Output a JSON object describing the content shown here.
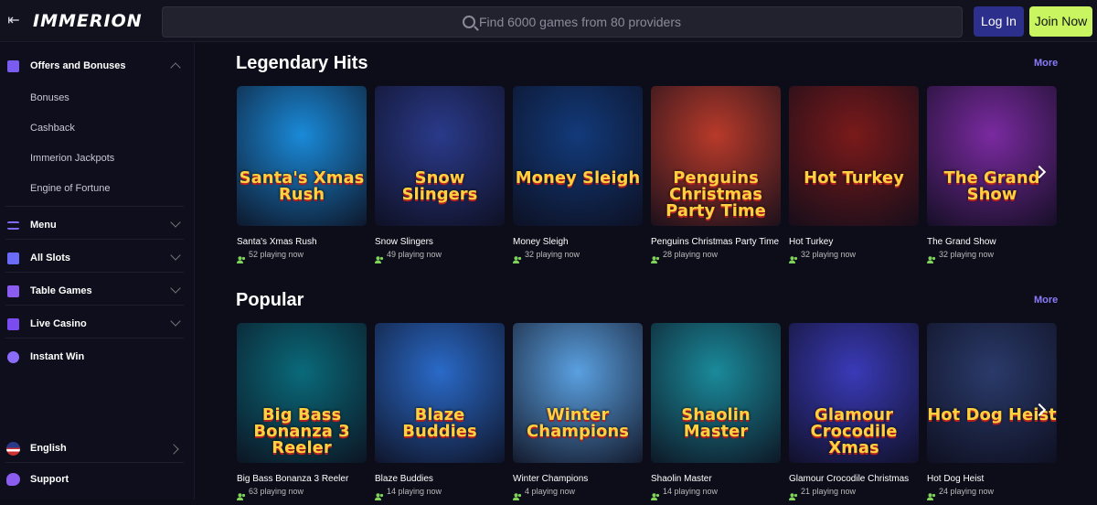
{
  "header": {
    "logo": "IMMERION",
    "search_placeholder": "Find 6000 games from 80 providers",
    "login_label": "Log In",
    "join_label": "Join Now"
  },
  "sidebar": {
    "offers": {
      "label": "Offers and Bonuses",
      "icon": "gift-icon"
    },
    "subitems": [
      "Bonuses",
      "Cashback",
      "Immerion Jackpots",
      "Engine of Fortune"
    ],
    "menu": {
      "label": "Menu",
      "icon": "menu-icon"
    },
    "all_slots": {
      "label": "All Slots",
      "icon": "grid-icon"
    },
    "table_games": {
      "label": "Table Games",
      "icon": "dice-icon"
    },
    "live_casino": {
      "label": "Live Casino",
      "icon": "play-icon"
    },
    "instant_win": {
      "label": "Instant Win",
      "icon": "burst-icon"
    },
    "language": {
      "label": "English",
      "icon": "us-flag-icon"
    },
    "support": {
      "label": "Support",
      "icon": "chat-icon"
    }
  },
  "sections": [
    {
      "title": "Legendary Hits",
      "more": "More",
      "games": [
        {
          "title": "Santa's Xmas Rush",
          "players": "52 playing now",
          "logo": "Santa's Xmas Rush",
          "color": "#1a8ad8"
        },
        {
          "title": "Snow Slingers",
          "players": "49 playing now",
          "logo": "Snow Slingers",
          "color": "#2a3a8a"
        },
        {
          "title": "Money Sleigh",
          "players": "32 playing now",
          "logo": "Money Sleigh",
          "color": "#123a7a"
        },
        {
          "title": "Penguins Christmas Party Time",
          "players": "28 playing now",
          "logo": "Penguins Christmas Party Time",
          "color": "#b83a2a"
        },
        {
          "title": "Hot Turkey",
          "players": "32 playing now",
          "logo": "Hot Turkey",
          "color": "#7a1a1a"
        },
        {
          "title": "The Grand Show",
          "players": "32 playing now",
          "logo": "The Grand Show",
          "color": "#7a2aa0"
        }
      ]
    },
    {
      "title": "Popular",
      "more": "More",
      "games": [
        {
          "title": "Big Bass Bonanza 3 Reeler",
          "players": "63 playing now",
          "logo": "Big Bass Bonanza 3 Reeler",
          "color": "#0a6a7a"
        },
        {
          "title": "Blaze Buddies",
          "players": "14 playing now",
          "logo": "Blaze Buddies",
          "color": "#2a6ac8"
        },
        {
          "title": "Winter Champions",
          "players": "4 playing now",
          "logo": "Winter Champions",
          "color": "#5aa0e0"
        },
        {
          "title": "Shaolin Master",
          "players": "14 playing now",
          "logo": "Shaolin Master",
          "color": "#1a8a9a"
        },
        {
          "title": "Glamour Crocodile Christmas",
          "players": "21 playing now",
          "logo": "Glamour Crocodile Xmas",
          "color": "#3a3ab8"
        },
        {
          "title": "Hot Dog Heist",
          "players": "24 playing now",
          "logo": "Hot Dog Heist",
          "color": "#2a3a6a"
        }
      ]
    }
  ]
}
